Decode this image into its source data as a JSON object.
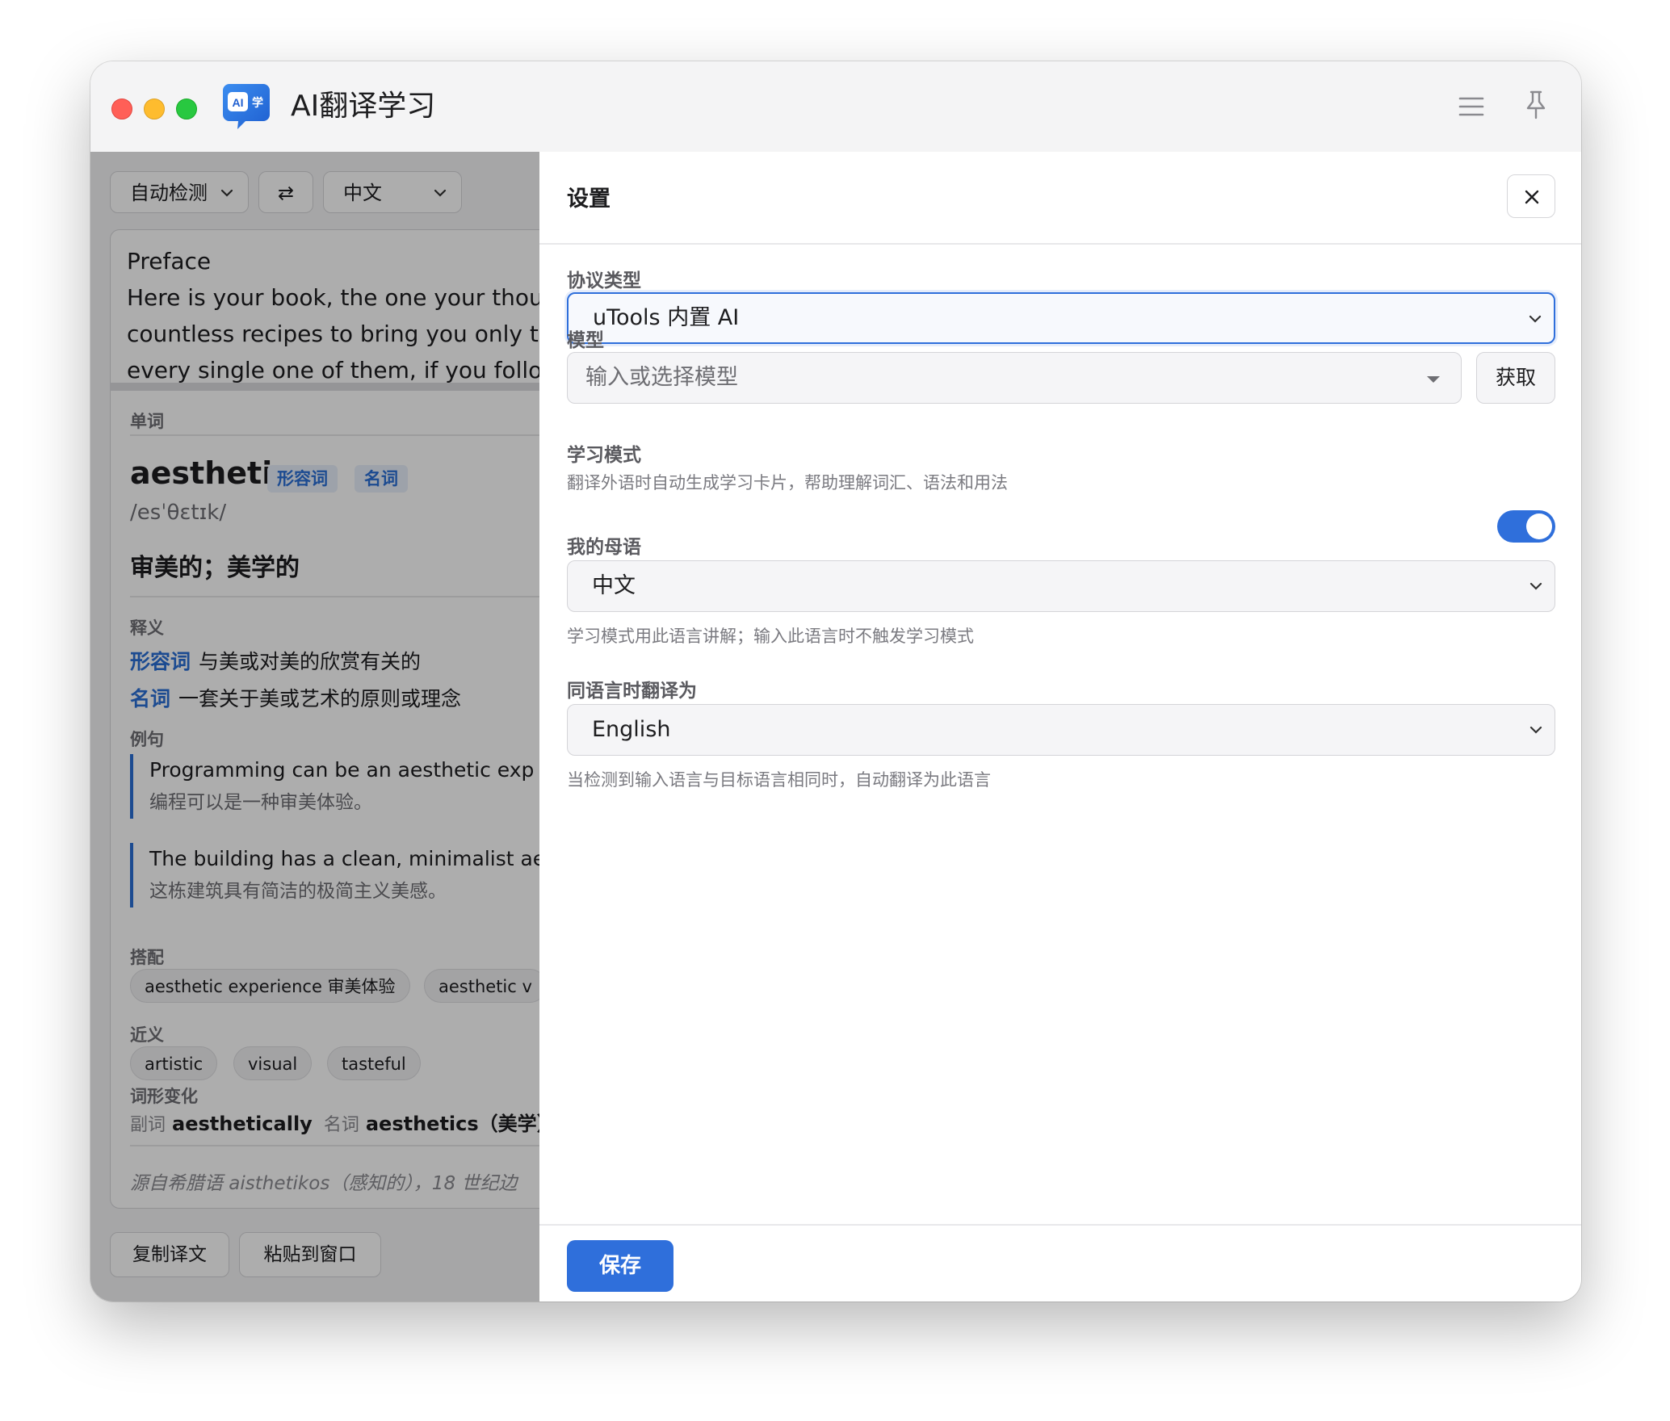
{
  "app": {
    "title": "AI翻译学习",
    "icon_text_left": "AI",
    "icon_text_right": "学"
  },
  "toolbar": {
    "source_lang": "自动检测",
    "swap_symbol": "⇄",
    "target_lang": "中文"
  },
  "source": {
    "lines": [
      "Preface",
      "Here is your book, the one your thousar",
      "countless recipes to bring you only the",
      "every single one of them, if you follow t"
    ]
  },
  "result": {
    "section_word": "单词",
    "word": "aesthetic",
    "pos_tags": [
      "形容词",
      "名词"
    ],
    "phonetic": "/esˈθɛtɪk/",
    "meaning": "审美的；美学的",
    "section_definitions": "释义",
    "definitions": [
      {
        "pos": "形容词",
        "text": "与美或对美的欣赏有关的"
      },
      {
        "pos": "名词",
        "text": "一套关于美或艺术的原则或理念"
      }
    ],
    "section_examples": "例句",
    "examples": [
      {
        "en": "Programming can be an aesthetic exp",
        "zh": "编程可以是一种审美体验。"
      },
      {
        "en": "The building has a clean, minimalist ae",
        "zh": "这栋建筑具有简洁的极简主义美感。"
      }
    ],
    "section_collocations": "搭配",
    "collocations": [
      "aesthetic experience 审美体验",
      "aesthetic v"
    ],
    "section_synonyms": "近义",
    "synonyms": [
      "artistic",
      "visual",
      "tasteful"
    ],
    "section_forms": "词形变化",
    "forms": [
      {
        "pos": "副词",
        "word": "aesthetically"
      },
      {
        "pos": "名词",
        "word": "aesthetics（美学）"
      }
    ],
    "etymology": "源自希腊语 aisthetikos（感知的），18 世纪边"
  },
  "bottom_buttons": {
    "copy": "复制译文",
    "paste": "粘贴到窗口"
  },
  "settings": {
    "title": "设置",
    "protocol": {
      "label": "协议类型",
      "value": "uTools 内置 AI"
    },
    "model": {
      "label": "模型",
      "placeholder": "输入或选择模型",
      "fetch_label": "获取"
    },
    "learning": {
      "label": "学习模式",
      "description": "翻译外语时自动生成学习卡片，帮助理解词汇、语法和用法",
      "enabled": true
    },
    "native": {
      "label": "我的母语",
      "value": "中文",
      "hint": "学习模式用此语言讲解；输入此语言时不触发学习模式"
    },
    "same_lang": {
      "label": "同语言时翻译为",
      "value": "English",
      "hint": "当检测到输入语言与目标语言相同时，自动翻译为此语言"
    },
    "save_label": "保存"
  },
  "colors": {
    "accent": "#2f6fdb",
    "close_red": "#ff5f57",
    "minimize_yellow": "#febc2e",
    "zoom_green": "#28c840"
  }
}
